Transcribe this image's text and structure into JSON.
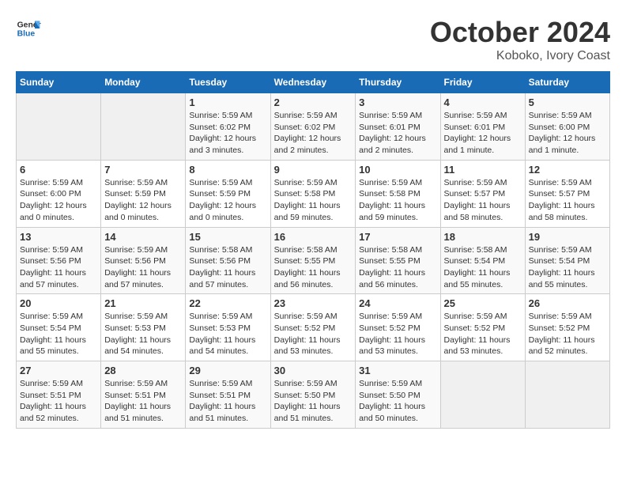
{
  "header": {
    "logo": {
      "general": "General",
      "blue": "Blue"
    },
    "title": "October 2024",
    "location": "Koboko, Ivory Coast"
  },
  "calendar": {
    "days_of_week": [
      "Sunday",
      "Monday",
      "Tuesday",
      "Wednesday",
      "Thursday",
      "Friday",
      "Saturday"
    ],
    "weeks": [
      [
        {
          "day": "",
          "sunrise": "",
          "sunset": "",
          "daylight": "",
          "empty": true
        },
        {
          "day": "",
          "sunrise": "",
          "sunset": "",
          "daylight": "",
          "empty": true
        },
        {
          "day": "1",
          "sunrise": "Sunrise: 5:59 AM",
          "sunset": "Sunset: 6:02 PM",
          "daylight": "Daylight: 12 hours and 3 minutes."
        },
        {
          "day": "2",
          "sunrise": "Sunrise: 5:59 AM",
          "sunset": "Sunset: 6:02 PM",
          "daylight": "Daylight: 12 hours and 2 minutes."
        },
        {
          "day": "3",
          "sunrise": "Sunrise: 5:59 AM",
          "sunset": "Sunset: 6:01 PM",
          "daylight": "Daylight: 12 hours and 2 minutes."
        },
        {
          "day": "4",
          "sunrise": "Sunrise: 5:59 AM",
          "sunset": "Sunset: 6:01 PM",
          "daylight": "Daylight: 12 hours and 1 minute."
        },
        {
          "day": "5",
          "sunrise": "Sunrise: 5:59 AM",
          "sunset": "Sunset: 6:00 PM",
          "daylight": "Daylight: 12 hours and 1 minute."
        }
      ],
      [
        {
          "day": "6",
          "sunrise": "Sunrise: 5:59 AM",
          "sunset": "Sunset: 6:00 PM",
          "daylight": "Daylight: 12 hours and 0 minutes."
        },
        {
          "day": "7",
          "sunrise": "Sunrise: 5:59 AM",
          "sunset": "Sunset: 5:59 PM",
          "daylight": "Daylight: 12 hours and 0 minutes."
        },
        {
          "day": "8",
          "sunrise": "Sunrise: 5:59 AM",
          "sunset": "Sunset: 5:59 PM",
          "daylight": "Daylight: 12 hours and 0 minutes."
        },
        {
          "day": "9",
          "sunrise": "Sunrise: 5:59 AM",
          "sunset": "Sunset: 5:58 PM",
          "daylight": "Daylight: 11 hours and 59 minutes."
        },
        {
          "day": "10",
          "sunrise": "Sunrise: 5:59 AM",
          "sunset": "Sunset: 5:58 PM",
          "daylight": "Daylight: 11 hours and 59 minutes."
        },
        {
          "day": "11",
          "sunrise": "Sunrise: 5:59 AM",
          "sunset": "Sunset: 5:57 PM",
          "daylight": "Daylight: 11 hours and 58 minutes."
        },
        {
          "day": "12",
          "sunrise": "Sunrise: 5:59 AM",
          "sunset": "Sunset: 5:57 PM",
          "daylight": "Daylight: 11 hours and 58 minutes."
        }
      ],
      [
        {
          "day": "13",
          "sunrise": "Sunrise: 5:59 AM",
          "sunset": "Sunset: 5:56 PM",
          "daylight": "Daylight: 11 hours and 57 minutes."
        },
        {
          "day": "14",
          "sunrise": "Sunrise: 5:59 AM",
          "sunset": "Sunset: 5:56 PM",
          "daylight": "Daylight: 11 hours and 57 minutes."
        },
        {
          "day": "15",
          "sunrise": "Sunrise: 5:58 AM",
          "sunset": "Sunset: 5:56 PM",
          "daylight": "Daylight: 11 hours and 57 minutes."
        },
        {
          "day": "16",
          "sunrise": "Sunrise: 5:58 AM",
          "sunset": "Sunset: 5:55 PM",
          "daylight": "Daylight: 11 hours and 56 minutes."
        },
        {
          "day": "17",
          "sunrise": "Sunrise: 5:58 AM",
          "sunset": "Sunset: 5:55 PM",
          "daylight": "Daylight: 11 hours and 56 minutes."
        },
        {
          "day": "18",
          "sunrise": "Sunrise: 5:58 AM",
          "sunset": "Sunset: 5:54 PM",
          "daylight": "Daylight: 11 hours and 55 minutes."
        },
        {
          "day": "19",
          "sunrise": "Sunrise: 5:59 AM",
          "sunset": "Sunset: 5:54 PM",
          "daylight": "Daylight: 11 hours and 55 minutes."
        }
      ],
      [
        {
          "day": "20",
          "sunrise": "Sunrise: 5:59 AM",
          "sunset": "Sunset: 5:54 PM",
          "daylight": "Daylight: 11 hours and 55 minutes."
        },
        {
          "day": "21",
          "sunrise": "Sunrise: 5:59 AM",
          "sunset": "Sunset: 5:53 PM",
          "daylight": "Daylight: 11 hours and 54 minutes."
        },
        {
          "day": "22",
          "sunrise": "Sunrise: 5:59 AM",
          "sunset": "Sunset: 5:53 PM",
          "daylight": "Daylight: 11 hours and 54 minutes."
        },
        {
          "day": "23",
          "sunrise": "Sunrise: 5:59 AM",
          "sunset": "Sunset: 5:52 PM",
          "daylight": "Daylight: 11 hours and 53 minutes."
        },
        {
          "day": "24",
          "sunrise": "Sunrise: 5:59 AM",
          "sunset": "Sunset: 5:52 PM",
          "daylight": "Daylight: 11 hours and 53 minutes."
        },
        {
          "day": "25",
          "sunrise": "Sunrise: 5:59 AM",
          "sunset": "Sunset: 5:52 PM",
          "daylight": "Daylight: 11 hours and 53 minutes."
        },
        {
          "day": "26",
          "sunrise": "Sunrise: 5:59 AM",
          "sunset": "Sunset: 5:52 PM",
          "daylight": "Daylight: 11 hours and 52 minutes."
        }
      ],
      [
        {
          "day": "27",
          "sunrise": "Sunrise: 5:59 AM",
          "sunset": "Sunset: 5:51 PM",
          "daylight": "Daylight: 11 hours and 52 minutes."
        },
        {
          "day": "28",
          "sunrise": "Sunrise: 5:59 AM",
          "sunset": "Sunset: 5:51 PM",
          "daylight": "Daylight: 11 hours and 51 minutes."
        },
        {
          "day": "29",
          "sunrise": "Sunrise: 5:59 AM",
          "sunset": "Sunset: 5:51 PM",
          "daylight": "Daylight: 11 hours and 51 minutes."
        },
        {
          "day": "30",
          "sunrise": "Sunrise: 5:59 AM",
          "sunset": "Sunset: 5:50 PM",
          "daylight": "Daylight: 11 hours and 51 minutes."
        },
        {
          "day": "31",
          "sunrise": "Sunrise: 5:59 AM",
          "sunset": "Sunset: 5:50 PM",
          "daylight": "Daylight: 11 hours and 50 minutes."
        },
        {
          "day": "",
          "sunrise": "",
          "sunset": "",
          "daylight": "",
          "empty": true
        },
        {
          "day": "",
          "sunrise": "",
          "sunset": "",
          "daylight": "",
          "empty": true
        }
      ]
    ]
  }
}
